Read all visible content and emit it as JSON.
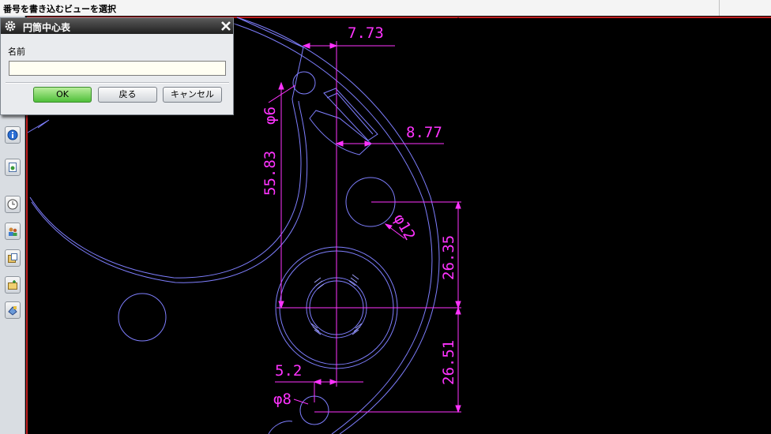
{
  "status_bar": {
    "prompt": "番号を書き込むビューを選択"
  },
  "toolbar": {
    "icons": [
      "info-icon",
      "document-icon",
      "clock-icon",
      "users-icon",
      "paste-icon",
      "new-folder-icon",
      "shapes-icon"
    ]
  },
  "dialog": {
    "title": "円筒中心表",
    "name_label": "名前",
    "name_value": "",
    "ok_label": "OK",
    "back_label": "戻る",
    "cancel_label": "キャンセル"
  },
  "drawing": {
    "dimensions": {
      "width_top": "7.73",
      "diameter_6": "φ6",
      "height": "55.83",
      "width_mid": "8.77",
      "diameter_12": "φ12",
      "height_upper": "26.35",
      "height_lower": "26.51",
      "offset": "5.2",
      "diameter_8": "φ8"
    },
    "colors": {
      "background": "#000000",
      "geometry": "#7f7fff",
      "dimension": "#ff33ff",
      "border": "#ff2a2a"
    }
  }
}
